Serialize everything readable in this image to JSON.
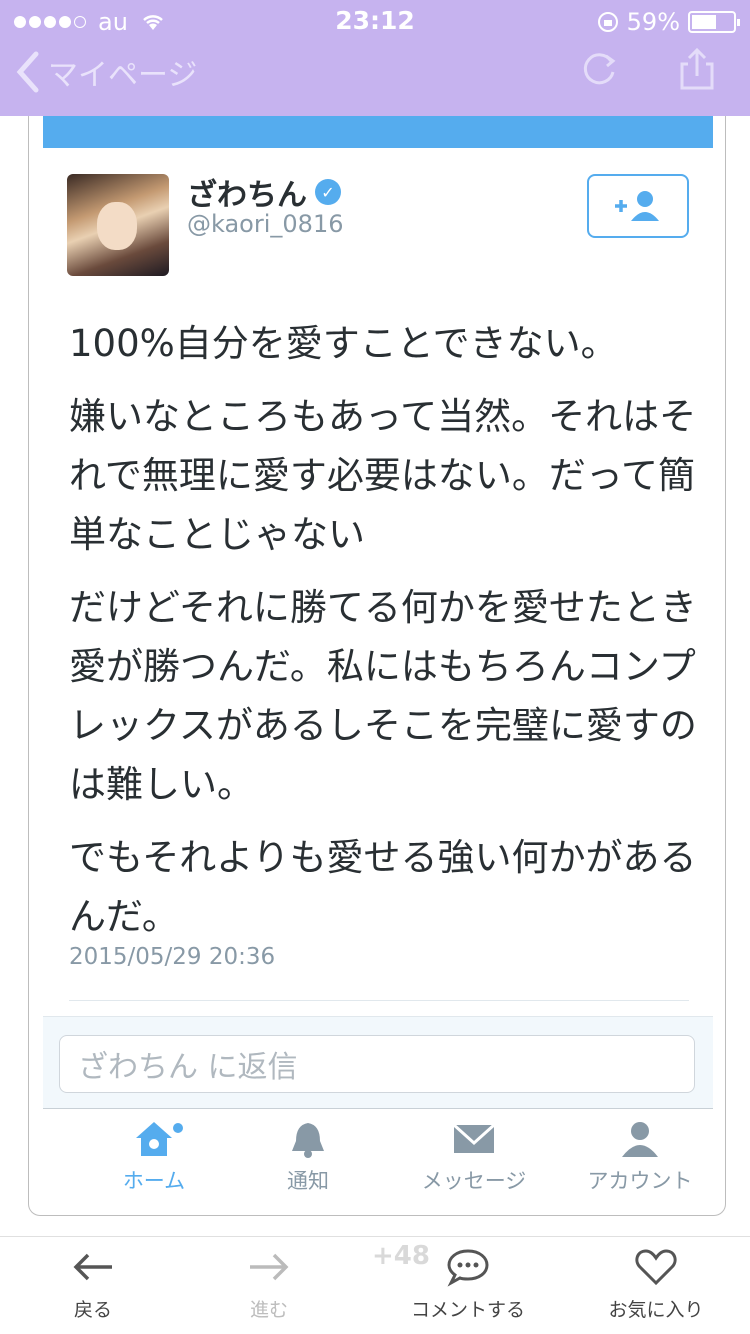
{
  "status_bar": {
    "carrier": "au",
    "time": "23:12",
    "battery": "59%",
    "battery_level": 0.59
  },
  "nav": {
    "back_label": "マイページ"
  },
  "tweet": {
    "display_name": "ざわちん",
    "handle": "@kaori_0816",
    "paragraphs": [
      "100%自分を愛すことできない。",
      "嫌いなところもあって当然。それはそれで無理に愛す必要はない。だって簡単なことじゃない",
      "だけどそれに勝てる何かを愛せたとき愛が勝つんだ。私にはもちろんコンプレックスがあるしそこを完璧に愛すのは難しい。",
      "でもそれよりも愛せる強い何かがあるんだ。"
    ],
    "timestamp": "2015/05/29 20:36"
  },
  "reply": {
    "placeholder": "ざわちん に返信"
  },
  "tabs": [
    {
      "label": "ホーム",
      "icon": "home-icon"
    },
    {
      "label": "通知",
      "icon": "bell-icon"
    },
    {
      "label": "メッセージ",
      "icon": "envelope-icon"
    },
    {
      "label": "アカウント",
      "icon": "person-icon"
    }
  ],
  "bottom_bar": {
    "back": "戻る",
    "forward": "進む",
    "comment": "コメントする",
    "favorite": "お気に入り",
    "count": "+48"
  },
  "colors": {
    "accent": "#55acee",
    "header": "#c6b3ef"
  }
}
